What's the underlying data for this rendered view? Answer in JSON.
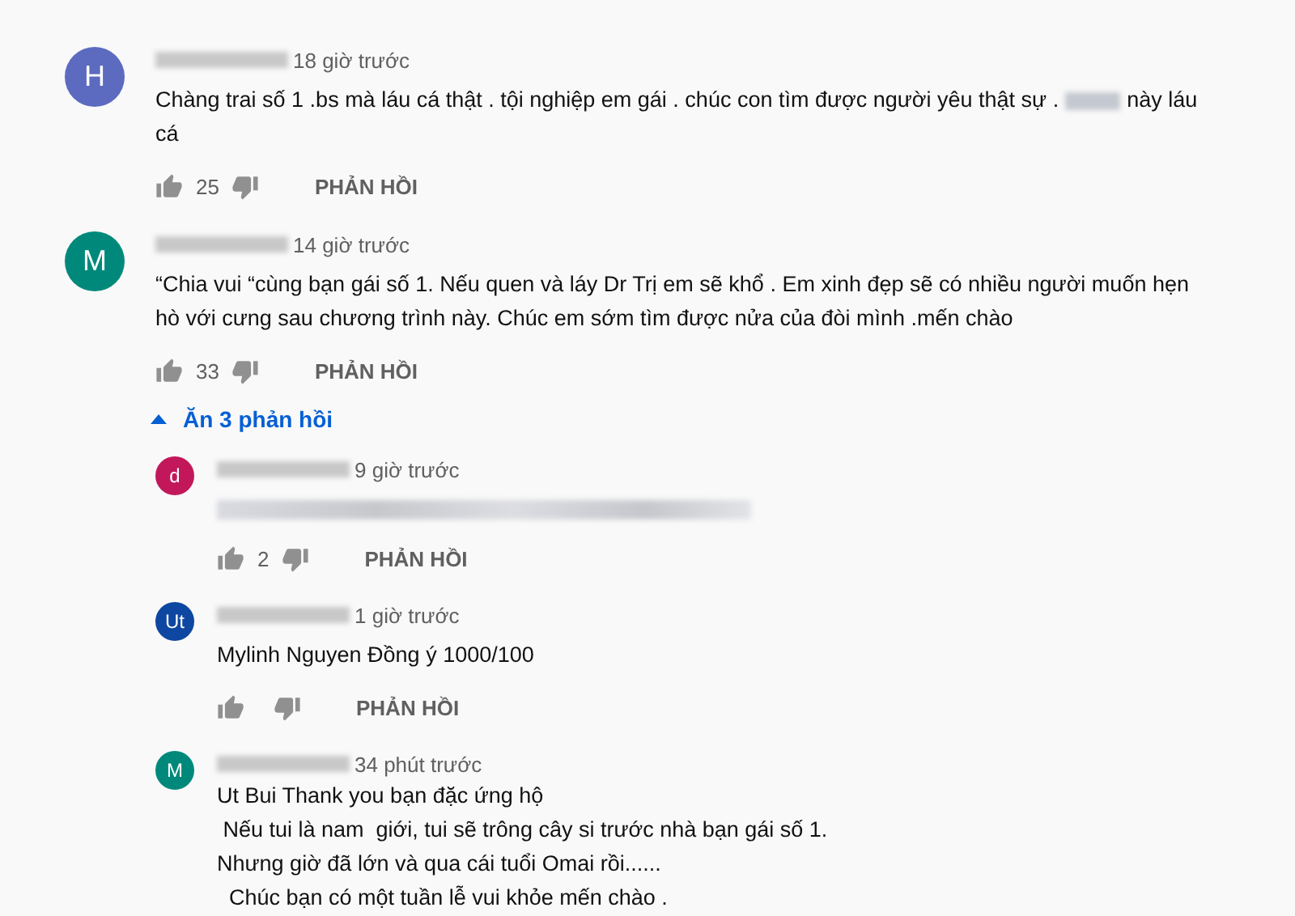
{
  "comments": [
    {
      "avatar": {
        "letter": "H",
        "color": "#5c6bc0"
      },
      "time": "18 giờ trước",
      "text": "Chàng trai số 1 .bs mà láu cá thật . tội nghiệp em gái . chúc con tìm được người yêu thật sự .",
      "text_after_redaction": "này láu cá",
      "likes": "25",
      "reply_label": "PHẢN HỒI"
    },
    {
      "avatar": {
        "letter": "M",
        "color": "#00897b"
      },
      "time": "14 giờ trước",
      "text": "“Chia vui “cùng bạn gái số 1. Nếu quen và láy Dr Trị em sẽ khổ . Em xinh đẹp sẽ có nhiều người muốn hẹn hò với cưng sau chương trình này. Chúc em sớm tìm được nửa của đòi mình .mến chào",
      "likes": "33",
      "reply_label": "PHẢN HỒI",
      "replies_toggle": {
        "label": "Ăn 3 phản hồi",
        "expanded": true
      },
      "replies": [
        {
          "avatar": {
            "letter": "d",
            "color": "#c2185b"
          },
          "time": "9 giờ trước",
          "text_redacted": true,
          "likes": "2",
          "reply_label": "PHẢN HỒI"
        },
        {
          "avatar": {
            "letter": "Ut",
            "color": "#0d47a1"
          },
          "time": "1 giờ trước",
          "text": "Mylinh Nguyen Đồng ý 1000/100",
          "reply_label": "PHẢN HỒI"
        },
        {
          "avatar": {
            "letter": "M",
            "color": "#00897b"
          },
          "time": "34 phút trước",
          "lines": [
            "Ut Bui Thank you bạn đặc ứng hộ",
            " Nếu tui là nam  giới, tui sẽ trông cây si trước nhà bạn gái số 1.",
            "Nhưng giờ đã lớn và qua cái tuổi Omai rồi......",
            "  Chúc bạn có một tuần lễ vui khỏe mến chào ."
          ]
        }
      ]
    }
  ]
}
